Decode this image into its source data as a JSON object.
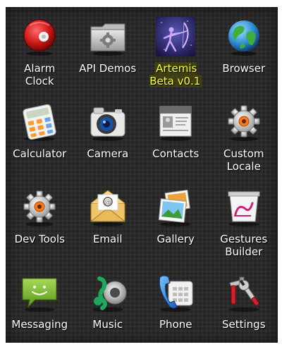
{
  "apps": [
    {
      "label": "Alarm\nClock",
      "icon": "alarm-clock-icon"
    },
    {
      "label": "API Demos",
      "icon": "folder-gear-icon"
    },
    {
      "label": "Artemis\nBeta v0.1",
      "icon": "artemis-archer-icon",
      "highlighted": true
    },
    {
      "label": "Browser",
      "icon": "globe-icon"
    },
    {
      "label": "Calculator",
      "icon": "calculator-icon"
    },
    {
      "label": "Camera",
      "icon": "camera-icon"
    },
    {
      "label": "Contacts",
      "icon": "contacts-card-icon"
    },
    {
      "label": "Custom\nLocale",
      "icon": "gear-icon"
    },
    {
      "label": "Dev Tools",
      "icon": "gear-icon"
    },
    {
      "label": "Email",
      "icon": "envelope-icon"
    },
    {
      "label": "Gallery",
      "icon": "photos-icon"
    },
    {
      "label": "Gestures\nBuilder",
      "icon": "gesture-pad-icon"
    },
    {
      "label": "Messaging",
      "icon": "speech-bubble-icon"
    },
    {
      "label": "Music",
      "icon": "music-speaker-icon"
    },
    {
      "label": "Phone",
      "icon": "telephone-icon"
    },
    {
      "label": "Settings",
      "icon": "tools-icon"
    }
  ],
  "colors": {
    "background": "#2b2b2b",
    "label": "#ffffff",
    "highlight_label": "#ffff33"
  }
}
